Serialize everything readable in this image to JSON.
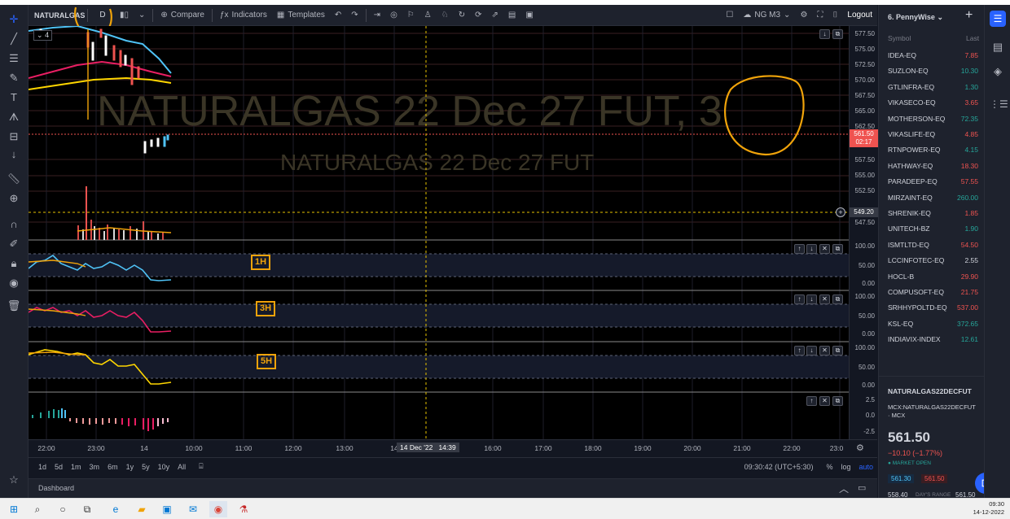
{
  "toolbar": {
    "symbol": "NATURALGAS",
    "interval": "D",
    "compare": "Compare",
    "indicators": "Indicators",
    "templates": "Templates",
    "cloud_label": "NG M3",
    "logout": "Logout"
  },
  "chart": {
    "watermark_big": "NATURALGAS 22 Dec 27 FUT, 3",
    "watermark_small": "NATURALGAS 22 Dec 27 FUT",
    "legend_count": "4",
    "price_ticks": [
      "577.50",
      "575.00",
      "572.50",
      "570.00",
      "567.50",
      "565.00",
      "562.50",
      "557.50",
      "555.00",
      "552.50",
      "547.50"
    ],
    "current_price": "561.50",
    "countdown": "02:17",
    "crosshair_price": "549.20",
    "panes": [
      {
        "label": "1H",
        "ticks": [
          "100.00",
          "50.00",
          "0.00"
        ]
      },
      {
        "label": "3H",
        "ticks": [
          "100.00",
          "50.00",
          "0.00"
        ]
      },
      {
        "label": "5H",
        "ticks": [
          "100.00",
          "50.00",
          "0.00"
        ]
      },
      {
        "label": "",
        "ticks": [
          "2.5",
          "0.0",
          "-2.5"
        ]
      }
    ],
    "time_ticks": [
      "22:00",
      "23:00",
      "14",
      "10:00",
      "11:00",
      "12:00",
      "13:00",
      "14",
      "16:00",
      "17:00",
      "18:00",
      "19:00",
      "20:00",
      "21:00",
      "22:00",
      "23:0"
    ],
    "crosshair_time": "14 Dec '22   14:39"
  },
  "ranges": [
    "1d",
    "5d",
    "1m",
    "3m",
    "6m",
    "1y",
    "5y",
    "10y",
    "All"
  ],
  "status": {
    "clock": "09:30:42 (UTC+5:30)",
    "percent": "%",
    "log": "log",
    "auto": "auto"
  },
  "dashboard": "Dashboard",
  "watchlist": {
    "title": "6. PennyWise",
    "col_symbol": "Symbol",
    "col_last": "Last",
    "rows": [
      {
        "symbol": "IDEA-EQ",
        "last": "7.85",
        "dir": "down"
      },
      {
        "symbol": "SUZLON-EQ",
        "last": "10.30",
        "dir": "up"
      },
      {
        "symbol": "GTLINFRA-EQ",
        "last": "1.30",
        "dir": "up"
      },
      {
        "symbol": "VIKASECO-EQ",
        "last": "3.65",
        "dir": "down"
      },
      {
        "symbol": "MOTHERSON-EQ",
        "last": "72.35",
        "dir": "up"
      },
      {
        "symbol": "VIKASLIFE-EQ",
        "last": "4.85",
        "dir": "down"
      },
      {
        "symbol": "RTNPOWER-EQ",
        "last": "4.15",
        "dir": "up"
      },
      {
        "symbol": "HATHWAY-EQ",
        "last": "18.30",
        "dir": "down"
      },
      {
        "symbol": "PARADEEP-EQ",
        "last": "57.55",
        "dir": "down"
      },
      {
        "symbol": "MIRZAINT-EQ",
        "last": "260.00",
        "dir": "up"
      },
      {
        "symbol": "SHRENIK-EQ",
        "last": "1.85",
        "dir": "down"
      },
      {
        "symbol": "UNITECH-BZ",
        "last": "1.90",
        "dir": "up"
      },
      {
        "symbol": "ISMTLTD-EQ",
        "last": "54.50",
        "dir": "down"
      },
      {
        "symbol": "LCCINFOTEC-EQ",
        "last": "2.55",
        "dir": "none"
      },
      {
        "symbol": "HOCL-B",
        "last": "29.90",
        "dir": "down"
      },
      {
        "symbol": "COMPUSOFT-EQ",
        "last": "21.75",
        "dir": "down"
      },
      {
        "symbol": "SRHHYPOLTD-EQ",
        "last": "537.00",
        "dir": "down"
      },
      {
        "symbol": "KSL-EQ",
        "last": "372.65",
        "dir": "up"
      },
      {
        "symbol": "INDIAVIX-INDEX",
        "last": "12.61",
        "dir": "up"
      }
    ]
  },
  "details": {
    "symbol": "NATURALGAS22DECFUT",
    "exchange": "MCX:NATURALGAS22DECFUT · MCX",
    "price": "561.50",
    "change": "−10.10 (−1.77%)",
    "market_status": "MARKET OPEN",
    "bid": "561.30",
    "ask": "561.50",
    "range_low": "558.40",
    "range_label": "DAY'S RANGE",
    "range_high": "561.50"
  },
  "taskbar": {
    "time": "09:30",
    "date": "14-12-2022"
  },
  "colors": {
    "up": "#26a69a",
    "down": "#ef5350",
    "accent": "#2962ff",
    "orange": "#f0a30a"
  }
}
